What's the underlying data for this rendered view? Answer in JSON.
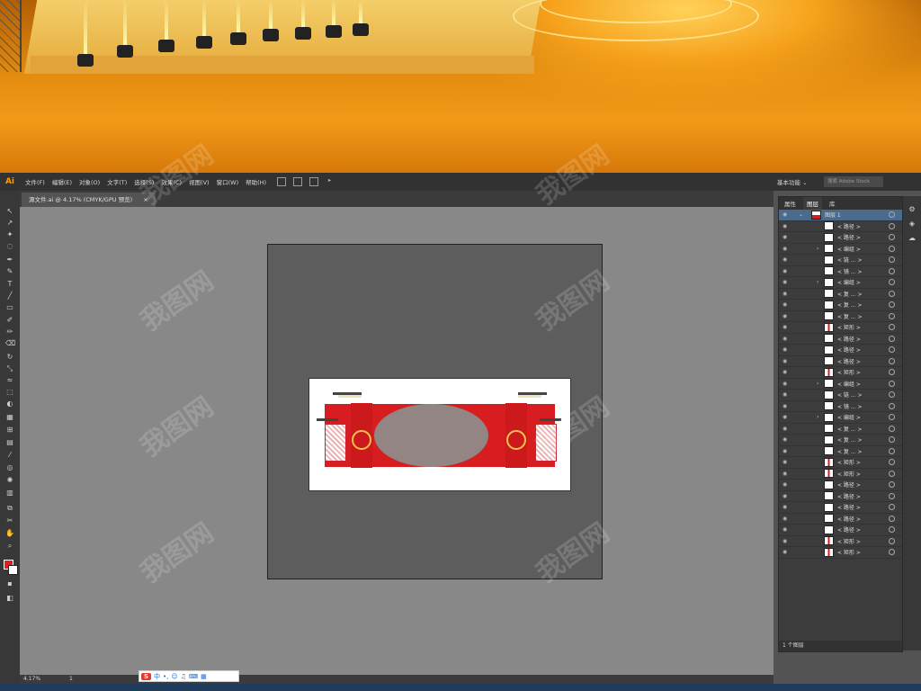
{
  "app": {
    "logo": "Ai"
  },
  "menu": [
    "文件(F)",
    "编辑(E)",
    "对象(O)",
    "文字(T)",
    "选择(S)",
    "效果(C)",
    "视图(V)",
    "窗口(W)",
    "帮助(H)"
  ],
  "workspace_label": "基本功能 ⌄",
  "stock_search": "搜索 Adobe Stock",
  "doc_tab": {
    "title": "源文件.ai @ 4.17% (CMYK/GPU 预览)",
    "close": "×"
  },
  "panel": {
    "tabs": [
      "属性",
      "图层",
      "库"
    ],
    "top_layer": "图层 1",
    "layers": [
      "< 路径 >",
      "< 路径 >",
      "< 编组 >",
      "< 链 ... >",
      "< 镜 ... >",
      "< 编组 >",
      "< 复 ... >",
      "< 复 ... >",
      "< 复 ... >",
      "< 矩形 >",
      "< 路径 >",
      "< 路径 >",
      "< 路径 >",
      "< 矩形 >",
      "< 编组 >",
      "< 链 ... >",
      "< 镜 ... >",
      "< 编组 >",
      "< 复 ... >",
      "< 复 ... >",
      "< 复 ... >",
      "< 矩形 >",
      "< 矩形 >",
      "< 路径 >",
      "< 路径 >",
      "< 路径 >",
      "< 路径 >",
      "< 路径 >",
      "< 矩形 >",
      "< 矩形 >"
    ],
    "footer": "1 个图层"
  },
  "status": {
    "zoom": "4.17%",
    "page": "1"
  },
  "ime": {
    "logo": "S",
    "mode": "中"
  },
  "watermark": "我图网",
  "colors": {
    "accent": "#ff9a00",
    "red": "#d71d20",
    "gold": "#f2c14e",
    "layer_highlight": "#4b6b8e"
  }
}
